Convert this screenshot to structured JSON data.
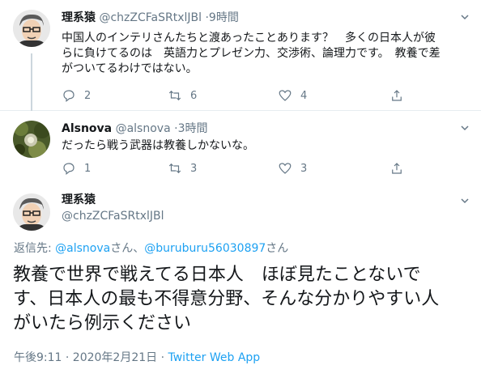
{
  "tweets": [
    {
      "name": "理系猿",
      "handle": "@chzZCFaSRtxlJBl",
      "sep": "·",
      "time": "9時間",
      "text": "中国人のインテリさんたちと渡あったことあります？　多くの日本人が彼\nらに負けてるのは　英語力とプレゼン力、交渉術、論理力です。　教養で差\nがついてるわけではない。",
      "replies": "2",
      "retweets": "6",
      "likes": "4"
    },
    {
      "name": "Alsnova",
      "handle": "@alsnova",
      "sep": "·",
      "time": "3時間",
      "text": "だったら戦う武器は教養しかないな。",
      "replies": "1",
      "retweets": "3",
      "likes": "3"
    }
  ],
  "main": {
    "name": "理系猿",
    "handle": "@chzZCFaSRtxlJBl",
    "reply_prefix": "返信先: ",
    "reply_user1": "@alsnova",
    "reply_san1": "さん、",
    "reply_user2": "@buruburu56030897",
    "reply_san2": "さん",
    "text": "教養で世界で戦えてる日本人　ほぼ見たことないで\nす、日本人の最も不得意分野、そんな分かりやすい人\nがいたら例示ください",
    "time": "午後9:11 · 2020年2月21日 · ",
    "app": "Twitter Web App"
  },
  "colors": {
    "link": "#1da1f2",
    "secondary": "#657786",
    "border": "#e6ecf0"
  },
  "icons": [
    "reply-icon",
    "retweet-icon",
    "like-icon",
    "share-icon",
    "chevron-down-icon"
  ]
}
